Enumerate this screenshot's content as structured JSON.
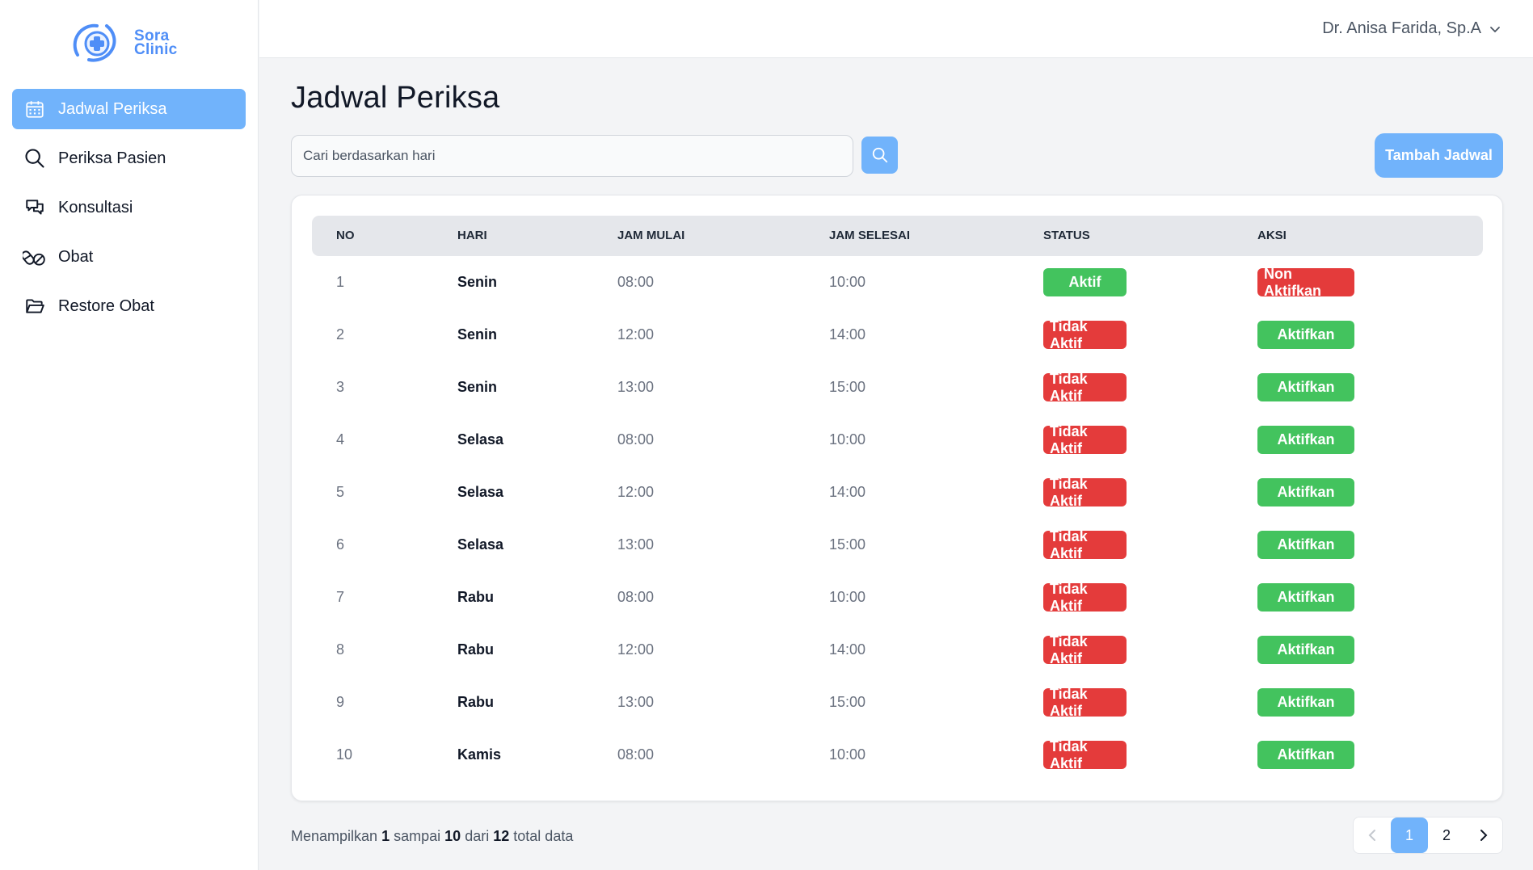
{
  "brand": {
    "line1": "Sora",
    "line2": "Clinic",
    "color": "#4f8ef7"
  },
  "sidebar": {
    "items": [
      {
        "label": "Jadwal Periksa",
        "icon": "calendar-icon",
        "active": true
      },
      {
        "label": "Periksa Pasien",
        "icon": "search-icon",
        "active": false
      },
      {
        "label": "Konsultasi",
        "icon": "chat-icon",
        "active": false
      },
      {
        "label": "Obat",
        "icon": "pills-icon",
        "active": false
      },
      {
        "label": "Restore Obat",
        "icon": "folder-open-icon",
        "active": false
      }
    ]
  },
  "header": {
    "user_name": "Dr. Anisa Farida, Sp.A"
  },
  "main": {
    "title": "Jadwal Periksa",
    "search_placeholder": "Cari berdasarkan hari",
    "add_button": "Tambah Jadwal"
  },
  "table": {
    "headers": {
      "no": "NO",
      "hari": "HARI",
      "mulai": "JAM MULAI",
      "selesai": "JAM SELESAI",
      "status": "STATUS",
      "aksi": "AKSI"
    },
    "rows": [
      {
        "no": "1",
        "hari": "Senin",
        "mulai": "08:00",
        "selesai": "10:00",
        "status": "Aktif",
        "aksi": "Non Aktifkan"
      },
      {
        "no": "2",
        "hari": "Senin",
        "mulai": "12:00",
        "selesai": "14:00",
        "status": "Tidak Aktif",
        "aksi": "Aktifkan"
      },
      {
        "no": "3",
        "hari": "Senin",
        "mulai": "13:00",
        "selesai": "15:00",
        "status": "Tidak Aktif",
        "aksi": "Aktifkan"
      },
      {
        "no": "4",
        "hari": "Selasa",
        "mulai": "08:00",
        "selesai": "10:00",
        "status": "Tidak Aktif",
        "aksi": "Aktifkan"
      },
      {
        "no": "5",
        "hari": "Selasa",
        "mulai": "12:00",
        "selesai": "14:00",
        "status": "Tidak Aktif",
        "aksi": "Aktifkan"
      },
      {
        "no": "6",
        "hari": "Selasa",
        "mulai": "13:00",
        "selesai": "15:00",
        "status": "Tidak Aktif",
        "aksi": "Aktifkan"
      },
      {
        "no": "7",
        "hari": "Rabu",
        "mulai": "08:00",
        "selesai": "10:00",
        "status": "Tidak Aktif",
        "aksi": "Aktifkan"
      },
      {
        "no": "8",
        "hari": "Rabu",
        "mulai": "12:00",
        "selesai": "14:00",
        "status": "Tidak Aktif",
        "aksi": "Aktifkan"
      },
      {
        "no": "9",
        "hari": "Rabu",
        "mulai": "13:00",
        "selesai": "15:00",
        "status": "Tidak Aktif",
        "aksi": "Aktifkan"
      },
      {
        "no": "10",
        "hari": "Kamis",
        "mulai": "08:00",
        "selesai": "10:00",
        "status": "Tidak Aktif",
        "aksi": "Aktifkan"
      }
    ]
  },
  "pagination": {
    "prefix": "Menampilkan",
    "from": "1",
    "to_word": "sampai",
    "to": "10",
    "of_word": "dari",
    "total": "12",
    "suffix": "total data",
    "pages": [
      "1",
      "2"
    ],
    "current": "1"
  },
  "colors": {
    "accent": "#71b3fb",
    "active_green": "#43c35e",
    "inactive_red": "#e43b3b"
  }
}
